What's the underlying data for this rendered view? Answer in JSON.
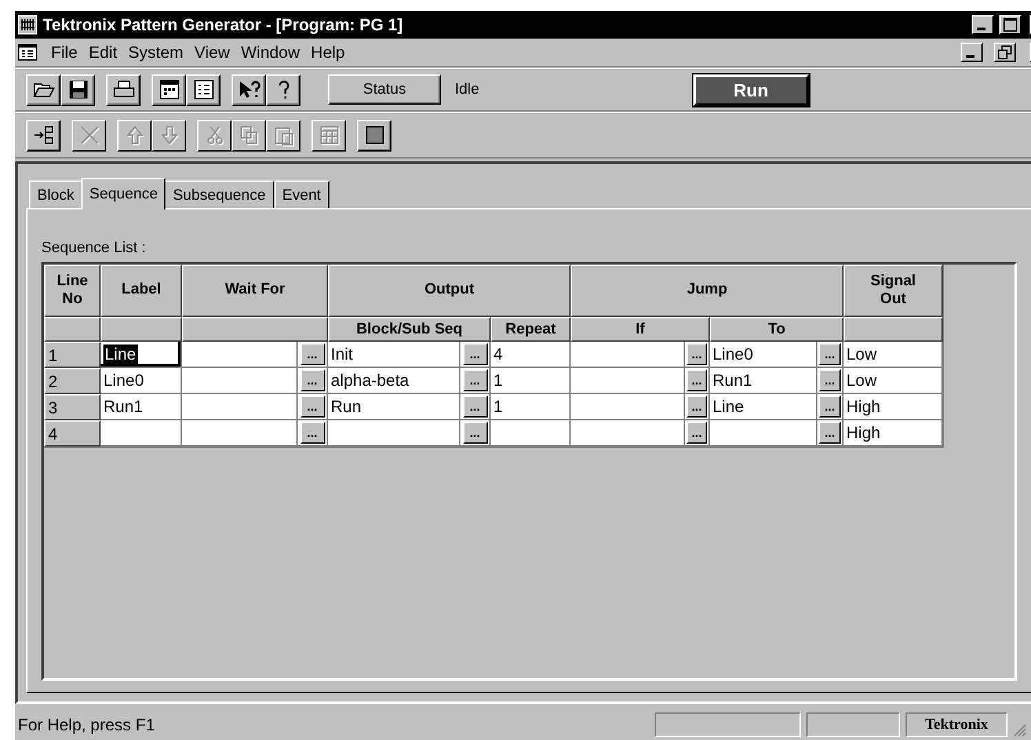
{
  "window": {
    "title": "Tektronix Pattern Generator - [Program: PG 1]"
  },
  "menu": [
    "File",
    "Edit",
    "System",
    "View",
    "Window",
    "Help"
  ],
  "toolbar": {
    "status_button": "Status",
    "status_value": "Idle",
    "run_button": "Run"
  },
  "toolbar2": [
    {
      "kind": "insert",
      "disabled": false
    },
    {
      "kind": "delete",
      "disabled": true
    },
    {
      "kind": "up",
      "disabled": true
    },
    {
      "kind": "down",
      "disabled": true
    },
    {
      "kind": "cut",
      "disabled": true
    },
    {
      "kind": "copy",
      "disabled": true
    },
    {
      "kind": "paste",
      "disabled": true
    },
    {
      "kind": "grid",
      "disabled": true
    },
    {
      "kind": "square",
      "disabled": false
    }
  ],
  "tabs": [
    {
      "label": "Block",
      "selected": false
    },
    {
      "label": "Sequence",
      "selected": true
    },
    {
      "label": "Subsequence",
      "selected": false
    },
    {
      "label": "Event",
      "selected": false
    }
  ],
  "sequence_list_label": "Sequence List :",
  "table": {
    "headers": [
      "Line No",
      "Label",
      "Wait For",
      "Output",
      "Jump",
      "Signal Out"
    ],
    "subheaders": [
      "Block/Sub Seq",
      "Repeat",
      "If",
      "To"
    ],
    "rows": [
      {
        "line_no": "1",
        "label": "Line",
        "label_selected": true,
        "wait_for": "",
        "block": "Init",
        "repeat": "4",
        "if": "",
        "to": "Line0",
        "signal_out": "Low",
        "pickers": [
          "...",
          "...",
          "...",
          "..."
        ]
      },
      {
        "line_no": "2",
        "label": "Line0",
        "label_selected": false,
        "wait_for": "",
        "block": "alpha-beta",
        "repeat": "1",
        "if": "",
        "to": "Run1",
        "signal_out": "Low",
        "pickers": [
          "...",
          "...",
          "...",
          "..."
        ]
      },
      {
        "line_no": "3",
        "label": "Run1",
        "label_selected": false,
        "wait_for": "",
        "block": "Run",
        "repeat": "1",
        "if": "",
        "to": "Line",
        "signal_out": "High",
        "pickers": [
          "...",
          "...",
          "...",
          "..."
        ]
      },
      {
        "line_no": "4",
        "label": "",
        "label_selected": false,
        "wait_for": "",
        "block": "",
        "repeat": "",
        "if": "",
        "to": "",
        "signal_out": "High",
        "pickers": [
          "...",
          "...",
          "...",
          "..."
        ]
      }
    ]
  },
  "status_bar": {
    "help": "For Help, press F1",
    "brand": "Tektronix"
  }
}
